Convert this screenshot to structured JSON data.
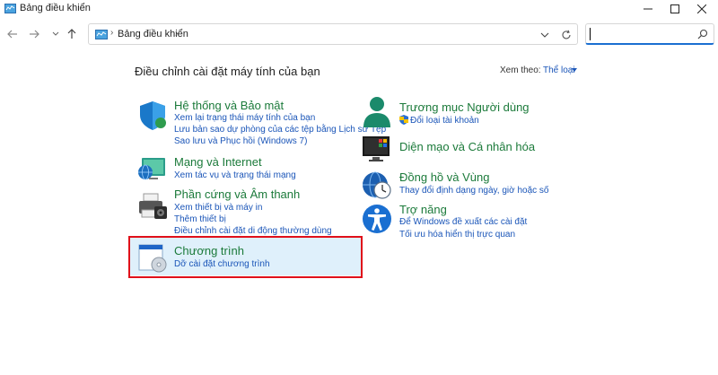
{
  "window": {
    "title": "Bảng điều khiển"
  },
  "address_bar": {
    "path": "Bảng điều khiển",
    "separator": "›",
    "chevron": "›"
  },
  "search": {
    "placeholder": ""
  },
  "content": {
    "heading": "Điều chỉnh cài đặt máy tính của bạn",
    "view_by_label": "Xem theo:",
    "view_by_value": "Thể loại"
  },
  "categories_left": [
    {
      "title": "Hệ thống và Bảo mật",
      "links": [
        "Xem lại trạng thái máy tính của bạn",
        "Lưu bản sao dự phòng của các tệp bằng Lịch sử Tệp",
        "Sao lưu và Phục hồi (Windows 7)"
      ]
    },
    {
      "title": "Mạng và Internet",
      "links": [
        "Xem tác vụ và trạng thái mạng"
      ]
    },
    {
      "title": "Phần cứng và Âm thanh",
      "links": [
        "Xem thiết bị và máy in",
        "Thêm thiết bị",
        "Điều chỉnh cài đặt di động thường dùng"
      ]
    },
    {
      "title": "Chương trình",
      "links": [
        "Dỡ cài đặt chương trình"
      ]
    }
  ],
  "categories_right": [
    {
      "title": "Trương mục Người dùng",
      "links": [
        "Đổi loại tài khoản"
      ]
    },
    {
      "title": "Diện mạo và Cá nhân hóa",
      "links": []
    },
    {
      "title": "Đồng hồ và Vùng",
      "links": [
        "Thay đổi định dạng ngày, giờ hoặc số"
      ]
    },
    {
      "title": "Trợ năng",
      "links": [
        "Để Windows đề xuất các cài đặt",
        "Tối ưu hóa hiển thị trực quan"
      ]
    }
  ],
  "colors": {
    "category_title": "#1b7a3a",
    "link": "#1a55b8",
    "highlight": "#dff0fb",
    "annotation_box": "#e0101a"
  }
}
